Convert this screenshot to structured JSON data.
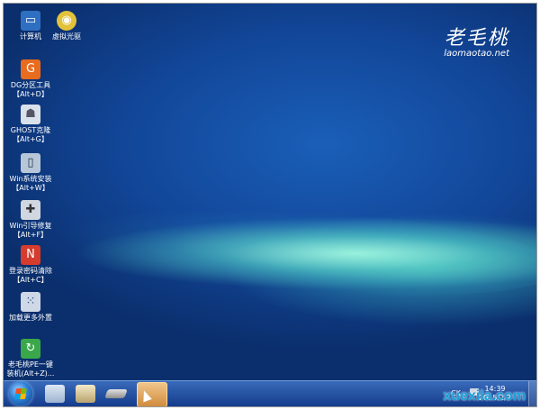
{
  "brand": {
    "logo_cn": "老毛桃",
    "logo_en": "laomaotao.net"
  },
  "desktop_icons": [
    {
      "label": "计算机",
      "icon": "computer-icon",
      "color": "#2f6fc2"
    },
    {
      "label": "虚拟光驱",
      "icon": "disc-icon",
      "color": "#e2c23a"
    },
    {
      "label": "DG分区工具\n【Alt+D】",
      "icon": "partition-tool-icon",
      "color": "#e96b1e"
    },
    {
      "label": "GHOST克隆\n【Alt+G】",
      "icon": "ghost-icon",
      "color": "#d9e1ea"
    },
    {
      "label": "Win系统安装\n【Alt+W】",
      "icon": "installer-icon",
      "color": "#b7c7d8"
    },
    {
      "label": "Win引导修复\n【Alt+F】",
      "icon": "boot-repair-icon",
      "color": "#d0d7e0"
    },
    {
      "label": "登录密码清除\n【Alt+C】",
      "icon": "password-clear-icon",
      "color": "#d63c2d"
    },
    {
      "label": "加载更多外置",
      "icon": "more-plugins-icon",
      "color": "#cfd8e6"
    },
    {
      "label": "老毛桃PE一键\n装机(Alt+Z)...",
      "icon": "one-click-install-icon",
      "color": "#3aa84a"
    }
  ],
  "taskbar": {
    "items": [
      {
        "icon": "start-orb-icon"
      },
      {
        "icon": "explorer-window-icon"
      },
      {
        "icon": "tools-icon"
      },
      {
        "icon": "drive-icon"
      },
      {
        "icon": "active-app-icon"
      }
    ],
    "tray": {
      "lang": "CK",
      "time": "14:39",
      "date": "2015/2/7"
    }
  },
  "watermark": "xuexila.com"
}
